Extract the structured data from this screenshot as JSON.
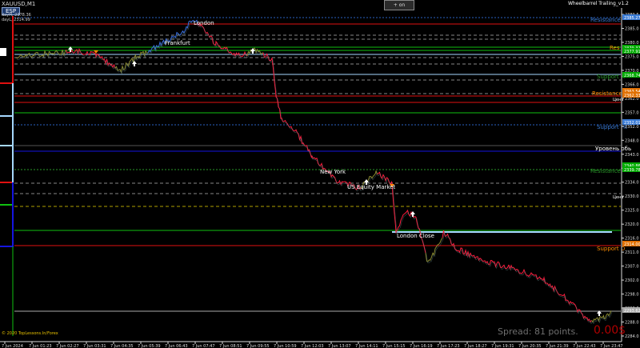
{
  "header": {
    "symbol": "XAUUSD,M1",
    "flag": "ESP",
    "day_high": "dayH, 2378.36",
    "day_low": "dayL, 2314.99",
    "top_button": "+ on",
    "ea_title": "Wheelbarrel Trailing_v1.2"
  },
  "footer": {
    "copyright": "© 2020 TopLessons.In/Forex",
    "spread": "Spread: 81 points.",
    "profit": "0.00$"
  },
  "colors": {
    "background": "#000000",
    "bull_series": "#ff1a3c",
    "bear_series": "#7a7a00",
    "resistance": "#e01010",
    "support": "#10c010",
    "pivot": "#1515e0",
    "light_blue": "#a6d8ff",
    "label_res": "#ff8c00",
    "label_sup": "#ffa000"
  },
  "price_axis": {
    "ticks": [
      "2389.5",
      "2385.0",
      "2380.0",
      "2375.0",
      "2370.0",
      "2366.0",
      "2362.0",
      "2357.0",
      "2352.0",
      "2348.0",
      "2343.0",
      "2338.0",
      "2334.0",
      "2330.0",
      "2325.0",
      "2320.0",
      "2316.0",
      "2311.0",
      "2307.0",
      "2302.0",
      "2298.0",
      "2293.0",
      "2288.0",
      "2284.0"
    ],
    "badges": [
      {
        "text": "2385.27",
        "color": "#3a7bd5"
      },
      {
        "text": "2379.32",
        "color": "#00aa00"
      },
      {
        "text": "2377.91",
        "color": "#00aa00"
      },
      {
        "text": "2368.74",
        "color": "#00aa00"
      },
      {
        "text": "2363.54",
        "color": "#e07000"
      },
      {
        "text": "2362.33",
        "color": "#e07000"
      },
      {
        "text": "2352.01",
        "color": "#3a7bd5"
      },
      {
        "text": "2340.86",
        "color": "#00aa00"
      },
      {
        "text": "2339.78",
        "color": "#00aa00"
      },
      {
        "text": "2314.00",
        "color": "#e07000"
      },
      {
        "text": "2293.62",
        "color": "#aaaaaa"
      }
    ]
  },
  "time_axis": [
    "7 Jun 2024",
    "7 Jun 01:23",
    "7 Jun 02:27",
    "7 Jun 03:31",
    "7 Jun 04:35",
    "7 Jun 05:39",
    "7 Jun 06:43",
    "7 Jun 07:47",
    "7 Jun 08:51",
    "7 Jun 09:55",
    "7 Jun 10:59",
    "7 Jun 12:03",
    "7 Jun 13:07",
    "7 Jun 14:11",
    "7 Jun 15:15",
    "7 Jun 16:19",
    "7 Jun 17:23",
    "7 Jun 18:27",
    "7 Jun 19:31",
    "7 Jun 20:35",
    "7 Jun 21:39",
    "7 Jun 22:43",
    "7 Jun 23:47"
  ],
  "level_labels": [
    {
      "text": "Resistance",
      "color": "#3a7bd5"
    },
    {
      "text": "Res",
      "color": "#ff8c00"
    },
    {
      "text": "Support H",
      "color": "#2a9a2a"
    },
    {
      "text": "Resistance",
      "color": "#ff8c00"
    },
    {
      "text": "Цена",
      "color": "#ffffff"
    },
    {
      "text": "Support Ht",
      "color": "#3a7bd5"
    },
    {
      "text": "Уровень обь",
      "color": "#ffffff"
    },
    {
      "text": "Resistance",
      "color": "#2a9a2a"
    },
    {
      "text": "Цена",
      "color": "#ffffff"
    },
    {
      "text": "Support D",
      "color": "#ff8c00"
    }
  ],
  "sessions": [
    "London",
    "Frankfurt",
    "New York",
    "US Equity Market",
    "London Close"
  ]
}
